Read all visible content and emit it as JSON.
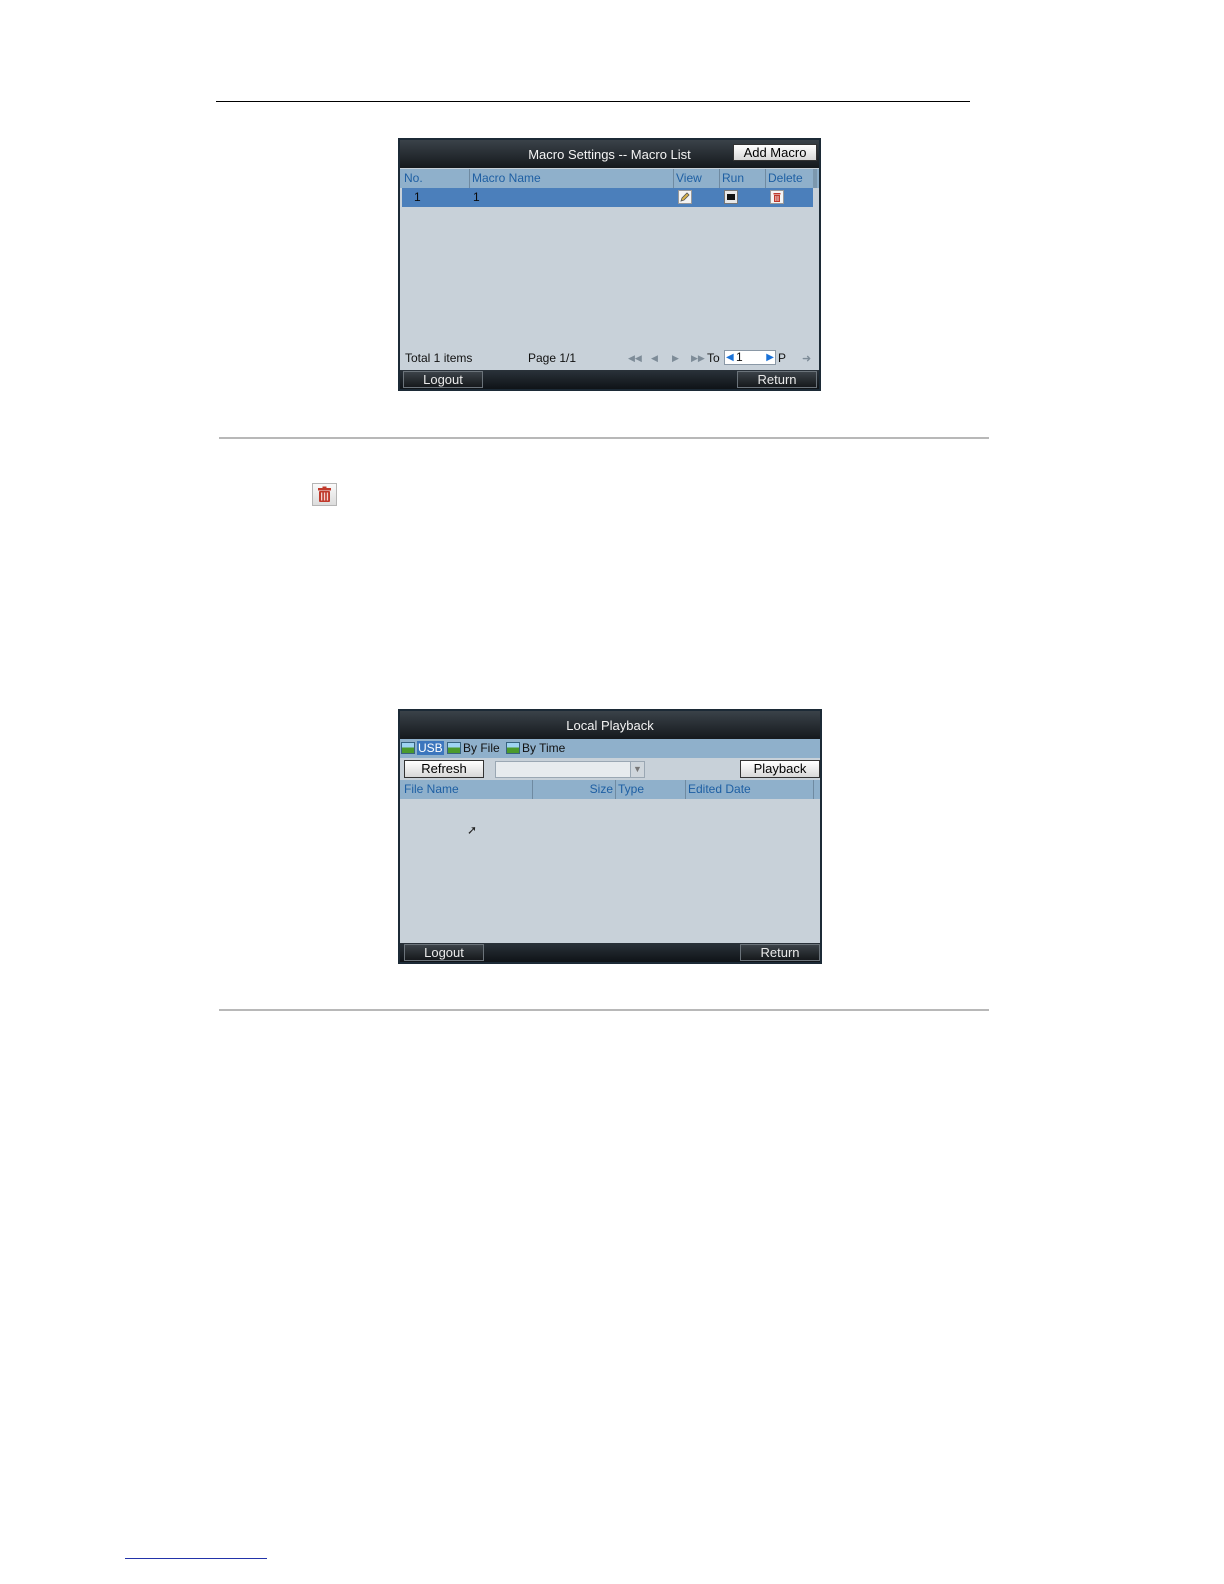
{
  "macro_window": {
    "title": "Macro Settings -- Macro List",
    "add_button": "Add Macro",
    "columns": [
      "No.",
      "Macro Name",
      "View",
      "Run",
      "Delete"
    ],
    "rows": [
      {
        "no": "1",
        "name": "1"
      }
    ],
    "row_icons": [
      "edit-icon",
      "run-icon",
      "delete-icon"
    ],
    "pager": {
      "total": "Total 1 items",
      "page": "Page 1/1",
      "to_label": "To",
      "page_value": "1",
      "p_label": "P"
    },
    "logout": "Logout",
    "return": "Return"
  },
  "standalone_icon": "trash-icon",
  "playback_window": {
    "title": "Local Playback",
    "tabs": [
      "USB",
      "By File",
      "By Time"
    ],
    "refresh": "Refresh",
    "playback": "Playback",
    "columns": [
      "File Name",
      "Size",
      "Type",
      "Edited Date"
    ],
    "logout": "Logout",
    "return": "Return"
  },
  "colors": {
    "title_bar": "#1c2126",
    "window_bg": "#c8d1d9",
    "header_bg": "#8fb0cb",
    "selected_row": "#4b7fbb",
    "delete_red": "#c0392b"
  }
}
